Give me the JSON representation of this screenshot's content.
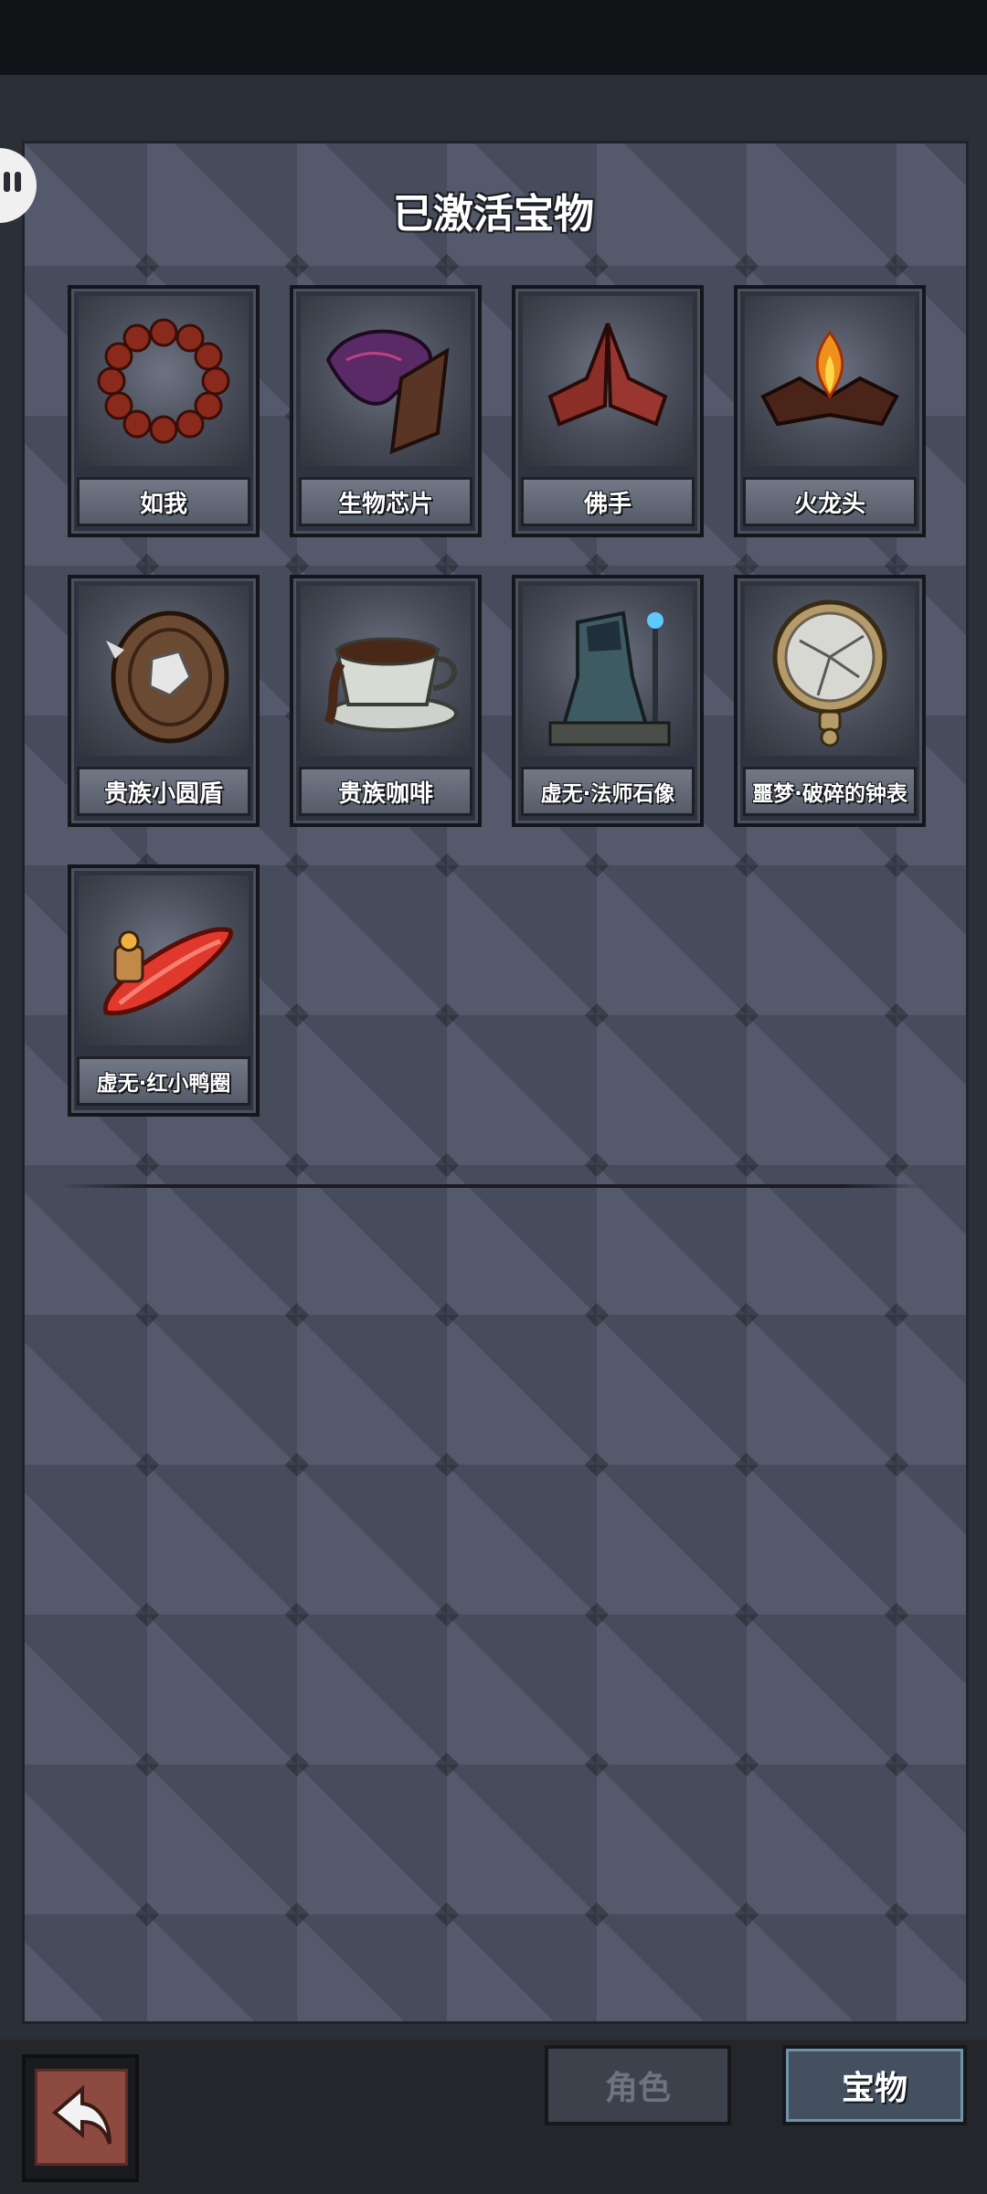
{
  "header": {
    "title": "已激活宝物"
  },
  "treasures": [
    {
      "name": "如我",
      "icon": "prayer-beads-icon"
    },
    {
      "name": "生物芯片",
      "icon": "bio-chip-icon"
    },
    {
      "name": "佛手",
      "icon": "buddha-hands-icon"
    },
    {
      "name": "火龙头",
      "icon": "fire-dragon-head-icon"
    },
    {
      "name": "贵族小圆盾",
      "icon": "round-shield-icon"
    },
    {
      "name": "贵族咖啡",
      "icon": "coffee-cup-icon"
    },
    {
      "name": "虚无·法师石像",
      "icon": "mage-statue-icon"
    },
    {
      "name": "噩梦·破碎的钟表",
      "icon": "broken-pocket-watch-icon"
    },
    {
      "name": "虚无·红小鸭圈",
      "icon": "red-duck-ring-icon"
    }
  ],
  "tabs": {
    "role": "角色",
    "treasure": "宝物"
  },
  "colors": {
    "panel": "#4b5163",
    "frame": "#2b2f38",
    "plate": "#727886",
    "back_button": "#8d4a40"
  }
}
